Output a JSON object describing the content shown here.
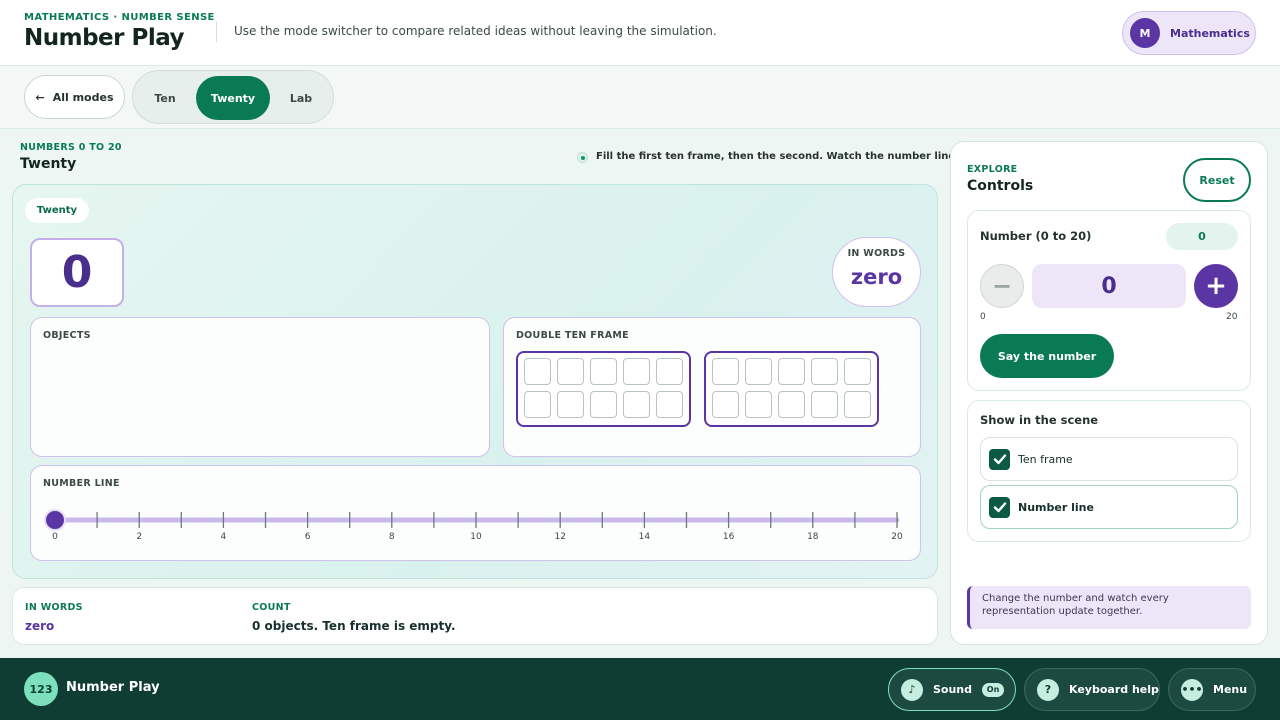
{
  "header": {
    "eyebrow": "MATHEMATICS · NUMBER SENSE",
    "title": "Number Play",
    "description": "Use the mode switcher to compare related ideas without leaving the simulation.",
    "subject_initial": "M",
    "subject_label": "Mathematics"
  },
  "modes": {
    "all_modes_label": "All modes",
    "back_arrow": "←",
    "items": [
      {
        "label": "Ten",
        "active": false
      },
      {
        "label": "Twenty",
        "active": true
      },
      {
        "label": "Lab",
        "active": false
      }
    ]
  },
  "scene": {
    "eyebrow": "NUMBERS 0 TO 20",
    "title": "Twenty",
    "hint": "Fill the first ten frame, then the second. Watch the number line too.",
    "chip": "Twenty",
    "big_number": "0",
    "in_words_label": "IN WORDS",
    "in_words_value": "zero",
    "objects_label": "OBJECTS",
    "double_ten_frame_label": "DOUBLE TEN FRAME",
    "frames_filled": 0,
    "number_line_label": "NUMBER LINE",
    "number_line": {
      "min": 0,
      "max": 20,
      "value": 0,
      "tick_labels": [
        "0",
        "2",
        "4",
        "6",
        "8",
        "10",
        "12",
        "14",
        "16",
        "18",
        "20"
      ]
    }
  },
  "summary": {
    "in_words_label": "IN WORDS",
    "in_words_value": "zero",
    "count_label": "COUNT",
    "count_value": "0 objects. Ten frame is empty."
  },
  "controls": {
    "eyebrow": "EXPLORE",
    "title": "Controls",
    "reset_label": "Reset",
    "number_label": "Number (0 to 20)",
    "number_badge": "0",
    "number_value": "0",
    "minus_symbol": "−",
    "plus_symbol": "+",
    "range_min": "0",
    "range_max": "20",
    "say_label": "Say the number",
    "show_label": "Show in the scene",
    "toggles": [
      {
        "label": "Ten frame",
        "checked": true
      },
      {
        "label": "Number line",
        "checked": true
      }
    ],
    "note": "Change the number and watch every representation update together."
  },
  "footer": {
    "logo_text": "123",
    "title": "Number Play",
    "sound_label": "Sound",
    "sound_state": "On",
    "sound_icon": "♪",
    "keyboard_label": "Keyboard help",
    "keyboard_icon": "?",
    "menu_label": "Menu",
    "menu_icon": "•••"
  },
  "colors": {
    "accent_green": "#0a7a55",
    "accent_purple": "#5a35a3",
    "footer_bg": "#0f3d33"
  }
}
